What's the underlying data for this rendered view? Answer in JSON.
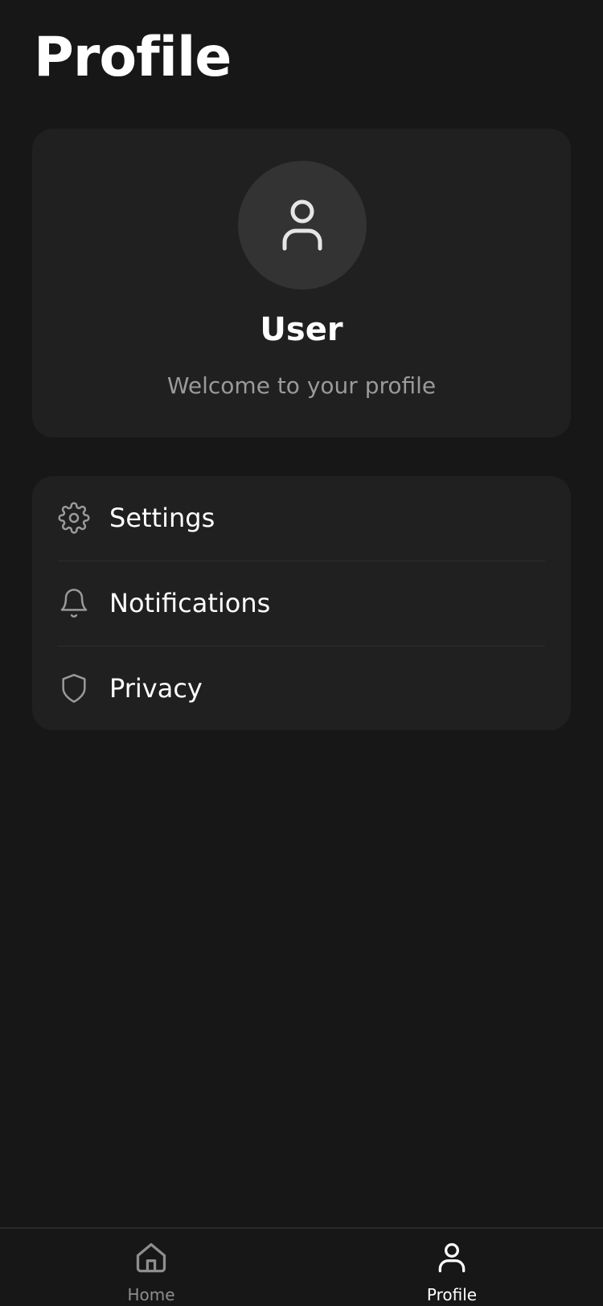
{
  "header": {
    "title": "Profile"
  },
  "profile_card": {
    "avatar_icon": "user-icon",
    "name": "User",
    "subtitle": "Welcome to your profile"
  },
  "menu": {
    "items": [
      {
        "label": "Settings",
        "icon": "gear-icon"
      },
      {
        "label": "Notifications",
        "icon": "bell-icon"
      },
      {
        "label": "Privacy",
        "icon": "shield-icon"
      }
    ]
  },
  "bottom_nav": {
    "items": [
      {
        "label": "Home",
        "icon": "home-icon",
        "active": false
      },
      {
        "label": "Profile",
        "icon": "user-icon",
        "active": true
      }
    ]
  },
  "colors": {
    "background": "#171717",
    "card": "#202020",
    "avatar_bg": "#333333",
    "muted_text": "#9a9a9a",
    "active_nav": "#ffffff",
    "inactive_nav": "#8e8e8e"
  }
}
